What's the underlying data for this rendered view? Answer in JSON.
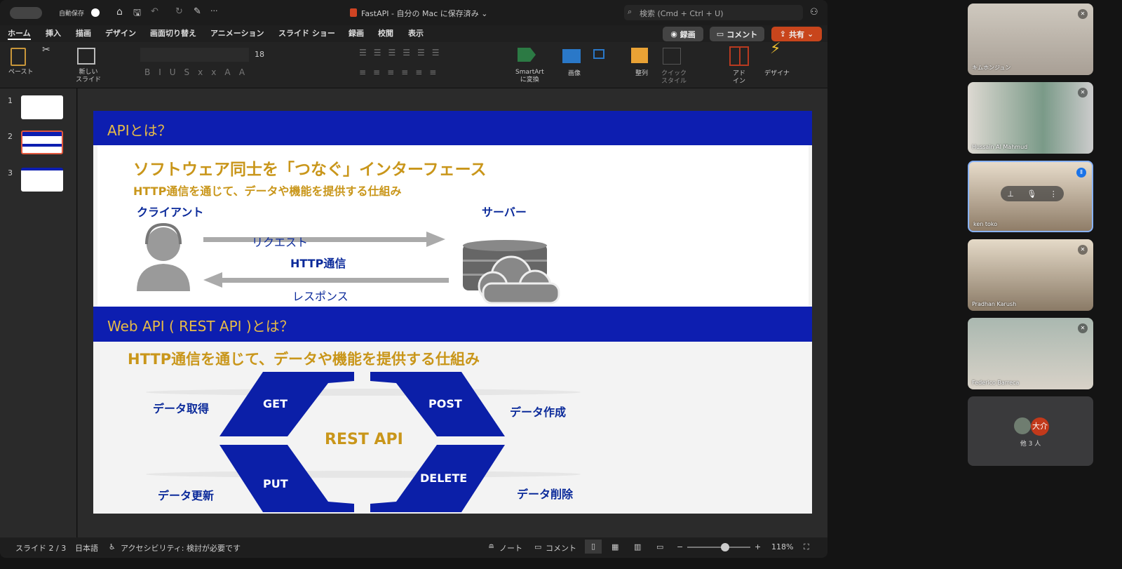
{
  "titlebar": {
    "autosave": "自動保存",
    "title": "FastAPI - 自分の Mac に保存済み ⌄",
    "search_placeholder": "検索 (Cmd + Ctrl + U)"
  },
  "tabs": [
    "ホーム",
    "挿入",
    "描画",
    "デザイン",
    "画面切り替え",
    "アニメーション",
    "スライド ショー",
    "録画",
    "校閲",
    "表示"
  ],
  "actions": {
    "record": "録画",
    "comment": "コメント",
    "share": "共有"
  },
  "ribbon": {
    "paste": "ペースト",
    "new_slide": "新しい\nスライド",
    "font_size": "18",
    "smartart": "SmartArt\nに変換",
    "image": "画像",
    "arrange": "整列",
    "quick_style": "クイック\nスタイル",
    "addin": "アド\nイン",
    "designer": "デザイナ"
  },
  "thumbnails": [
    "1",
    "2",
    "3"
  ],
  "slide": {
    "h1": "APIとは？",
    "sub1": "ソフトウェア同士を「つなぐ」インターフェース",
    "sub2": "HTTP通信を通じて、データや機能を提供する仕組み",
    "client": "クライアント",
    "server": "サーバー",
    "request": "リクエスト",
    "http": "HTTP通信",
    "response": "レスポンス",
    "h2": "Web API ( REST API )とは？",
    "sub3": "HTTP通信を通じて、データや機能を提供する仕組み",
    "rest": "REST API",
    "get": "GET",
    "post": "POST",
    "put": "PUT",
    "delete": "DELETE",
    "get_desc": "データ取得",
    "post_desc": "データ作成",
    "put_desc": "データ更新",
    "delete_desc": "データ削除"
  },
  "status": {
    "slide": "スライド 2 / 3",
    "lang": "日本語",
    "access": "アクセシビリティ: 検討が必要です",
    "notes": "ノート",
    "comments": "コメント",
    "zoom": "118%",
    "zoom_level": 0.6
  },
  "participants": [
    {
      "name": "キムホンジュン"
    },
    {
      "name": "Hussain Al Mahmud"
    },
    {
      "name": "ken toko"
    },
    {
      "name": "Pradhan Karush"
    },
    {
      "name": "Federico Barreca"
    }
  ],
  "others": {
    "avatar": "大介",
    "label": "他 3 人"
  }
}
